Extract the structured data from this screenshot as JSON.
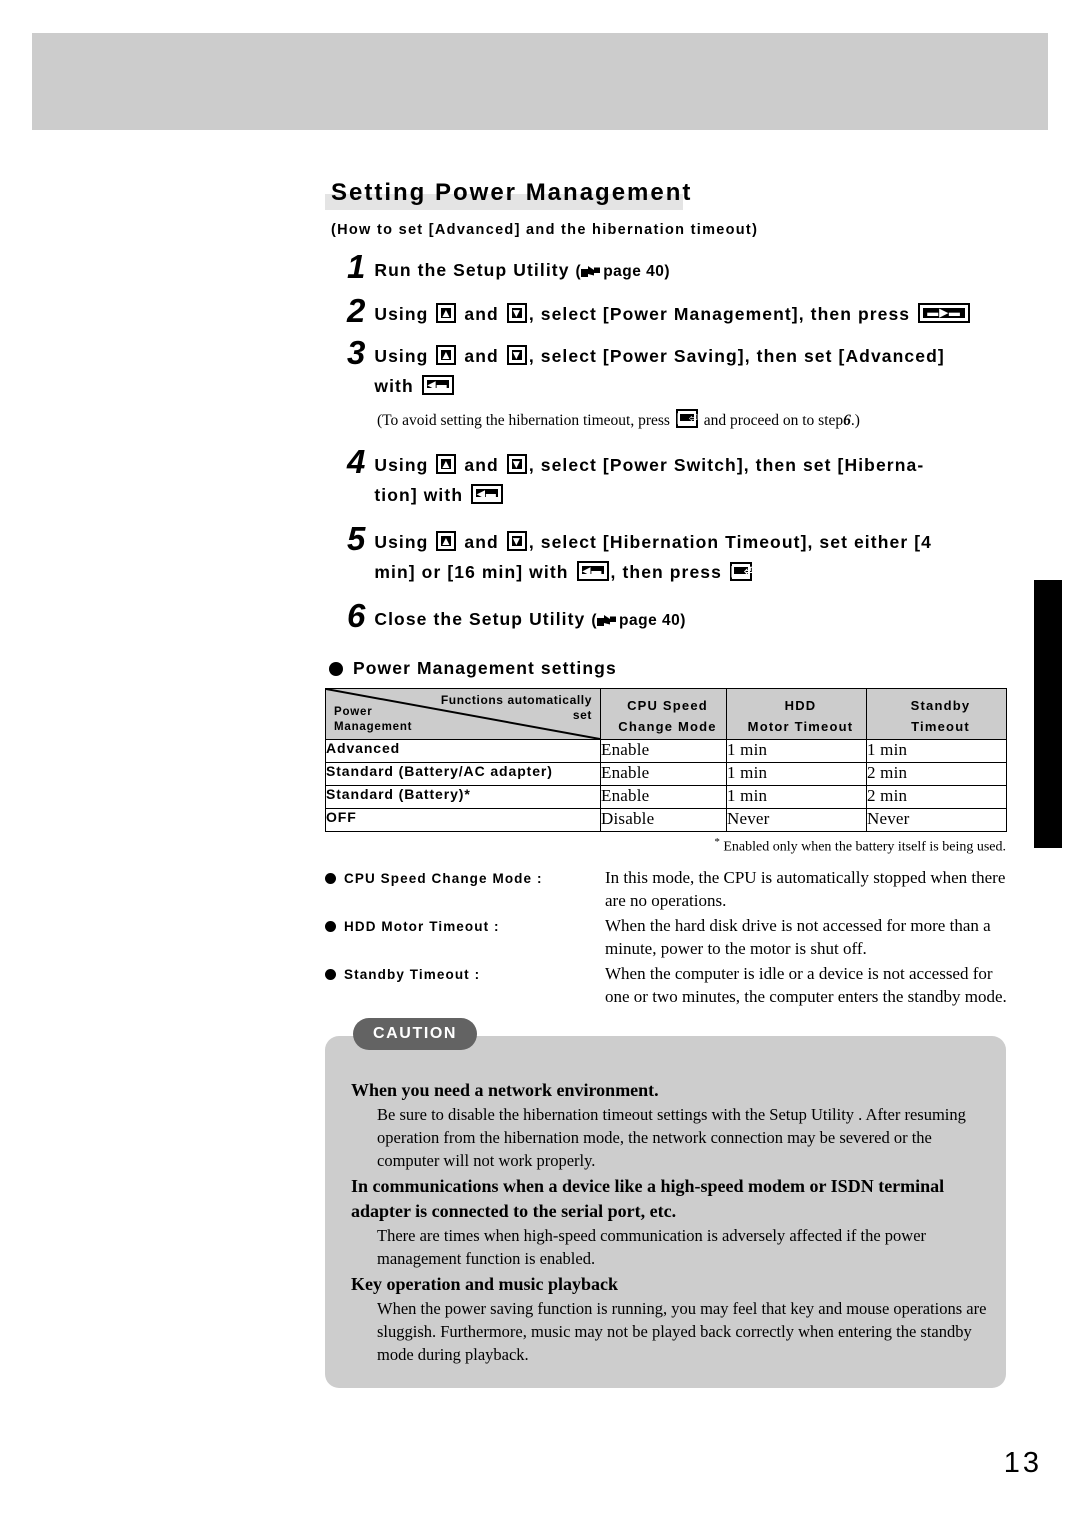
{
  "page": {
    "number": "13"
  },
  "section": {
    "title": "Setting Power Management",
    "subtitle": "(How to set [Advanced] and the hibernation timeout)"
  },
  "steps": [
    {
      "num": "1",
      "parts": [
        {
          "type": "text",
          "value": "Run the Setup Utility "
        },
        {
          "type": "pagelink",
          "value": "page 40)",
          "prefix": "("
        }
      ],
      "text": "Run the Setup Utility ( page 40)"
    },
    {
      "num": "2",
      "text": "Using  and , select [Power Management], then press "
    },
    {
      "num": "3",
      "text": "Using  and , select [Power Saving], then set [Advanced] with "
    },
    {
      "num": "4",
      "text": "Using  and , select [Power Switch], then set [Hibernation] with "
    },
    {
      "num": "5",
      "text": "Using  and , select [Hibernation Timeout], set either [4 min] or [16 min] with , then press "
    },
    {
      "num": "6",
      "text": "Close the Setup Utility ( page 40)"
    }
  ],
  "step_text": {
    "s1_a": "Run the Setup Utility",
    "s1_page": "page 40)",
    "s2_a": "Using",
    "s2_b": "and",
    "s2_c": ", select [Power Management], then press",
    "s3_a": "Using",
    "s3_b": "and",
    "s3_c": ", select [Power Saving], then set [Advanced]",
    "s3_d": "with",
    "s4_a": "Using",
    "s4_b": "and",
    "s4_c": ", select [Power Switch], then set [Hiberna-",
    "s4_d": "tion] with",
    "s5_a": "Using",
    "s5_b": "and",
    "s5_c": ", select [Hibernation Timeout], set either [4",
    "s5_d": "min] or [16 min] with",
    "s5_e": ", then press",
    "s6_a": "Close the Setup Utility",
    "s6_page": "page 40)"
  },
  "note": {
    "a": "(To avoid setting the hibernation timeout, press",
    "b": "and proceed on to step",
    "step": "6",
    "c": ".)"
  },
  "icons": {
    "arrow_up_key": "up-arrow-key",
    "arrow_down_key": "down-arrow-key",
    "enter_key": "enter-key",
    "space_key": "space-key",
    "esc_key": "esc-key",
    "hand_pointer": "hand-pointer-icon"
  },
  "settings_section": {
    "heading": "Power Management settings",
    "table": {
      "corner_top_label": "Functions automatically set",
      "corner_top_line1": "Functions automatically",
      "corner_top_line2": "set",
      "corner_bottom_line1": "Power",
      "corner_bottom_line2": "Management",
      "columns": [
        {
          "line1": "CPU Speed",
          "line2": "Change Mode"
        },
        {
          "line1": "HDD",
          "line2": "Motor Timeout"
        },
        {
          "line1": "Standby",
          "line2": "Timeout"
        }
      ],
      "rows": [
        {
          "label": "Advanced",
          "cpu": "Enable",
          "hdd": "1 min",
          "standby": "1 min"
        },
        {
          "label": "Standard (Battery/AC adapter)",
          "cpu": "Enable",
          "hdd": "1 min",
          "standby": "2 min"
        },
        {
          "label": "Standard (Battery)*",
          "cpu": "Enable",
          "hdd": "1 min",
          "standby": "2 min"
        },
        {
          "label": "OFF",
          "cpu": "Disable",
          "hdd": "Never",
          "standby": "Never"
        }
      ],
      "footnote_marker": "*",
      "footnote": "Enabled only when the battery itself is being used."
    },
    "definitions": [
      {
        "term": "CPU Speed Change Mode :",
        "desc": "In this mode, the CPU is automatically stopped when there are no operations."
      },
      {
        "term": "HDD Motor Timeout :",
        "desc": "When the hard disk drive is not accessed for more than a minute, power to the motor is shut off."
      },
      {
        "term": "Standby Timeout :",
        "desc": "When the computer is idle or a device is not accessed for one or two minutes, the computer enters the standby mode."
      }
    ]
  },
  "caution": {
    "tag": "CAUTION",
    "blocks": [
      {
        "heading": "When you need a network environment.",
        "body": "Be sure to disable the hibernation timeout settings with the Setup Utility .\nAfter resuming operation from the hibernation mode, the network connection may be severed or the computer will not work properly."
      },
      {
        "heading": "In communications when a device like a high-speed modem or ISDN terminal adapter is connected to the serial port, etc.",
        "body": "There are times when high-speed communication is adversely affected if the power management function is enabled."
      },
      {
        "heading": "Key operation and music playback",
        "body": "When the power saving function is running, you may feel that key and mouse operations are sluggish. Furthermore, music may not be played back correctly when entering the standby mode during playback."
      }
    ]
  },
  "colors": {
    "band_grey": "#cccccc",
    "caution_bg": "#cdcdcd",
    "caution_tag_bg": "#636363",
    "title_highlight": "#e4e4e4",
    "side_tab": "#000000"
  }
}
